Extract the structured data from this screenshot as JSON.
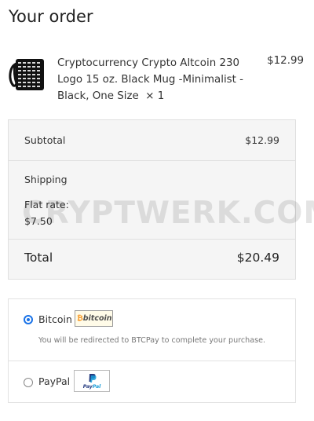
{
  "page": {
    "title": "Your order"
  },
  "order_item": {
    "name": "Cryptocurrency Crypto Altcoin 230 Logo 15 oz. Black Mug -Minimalist - Black, One Size",
    "quantity": "× 1",
    "price": "$12.99",
    "image_icon": "black-mug-icon"
  },
  "summary": {
    "subtotal_label": "Subtotal",
    "subtotal_value": "$12.99",
    "shipping_label": "Shipping",
    "shipping_rate_label": "Flat rate:",
    "shipping_rate_value": "$7.50",
    "total_label": "Total",
    "total_value": "$20.49"
  },
  "watermark": "CRYPTWERK.COM",
  "payment": {
    "methods": [
      {
        "label": "Bitcoin",
        "selected": true,
        "logo_text": "bitcoin",
        "logo_icon": "bitcoin-logo-icon",
        "description": "You will be redirected to BTCPay to complete your purchase."
      },
      {
        "label": "PayPal",
        "selected": false,
        "logo_text_pay": "Pay",
        "logo_text_pal": "Pal",
        "logo_icon": "paypal-logo-icon"
      }
    ]
  },
  "colors": {
    "accent": "#1a73e8",
    "summary_bg": "#f5f5f5",
    "bitcoin_orange": "#f7931a",
    "paypal_dark": "#253b80",
    "paypal_light": "#179bd7"
  }
}
